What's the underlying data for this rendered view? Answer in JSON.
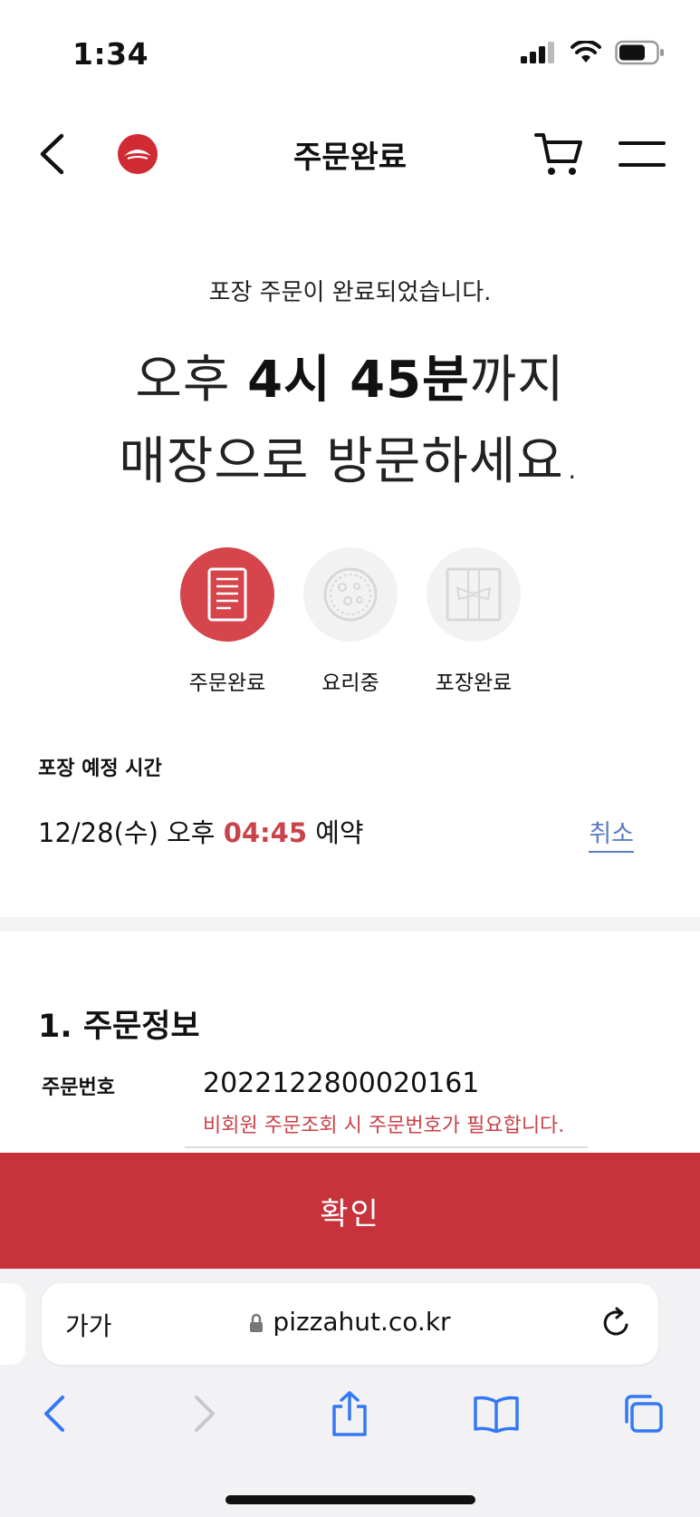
{
  "status_bar": {
    "time": "1:34"
  },
  "header": {
    "title": "주문완료"
  },
  "message": {
    "small": "포장 주문이 완료되었습니다.",
    "line1_prefix": "오후 ",
    "line1_bold": "4시 45분",
    "line1_suffix": "까지",
    "line2": "매장으로 방문하세요."
  },
  "steps": [
    {
      "label": "주문완료",
      "icon": "receipt-icon",
      "active": true
    },
    {
      "label": "요리중",
      "icon": "pizza-icon",
      "active": false
    },
    {
      "label": "포장완료",
      "icon": "package-icon",
      "active": false
    }
  ],
  "reservation": {
    "section_label": "포장 예정 시간",
    "date_prefix": "12/28(수) 오후 ",
    "time": "04:45",
    "suffix": " 예약",
    "cancel": "취소"
  },
  "order_info": {
    "title": "1. 주문정보",
    "order_no_label": "주문번호",
    "order_no": "2022122800020161",
    "note": "비회원 주문조회 시 주문번호가 필요합니다."
  },
  "confirm_button": "확인",
  "browser": {
    "aa": "가가",
    "url": "pizzahut.co.kr"
  },
  "colors": {
    "brand_red": "#c8333b",
    "accent_red": "#d5454b",
    "link_blue": "#5a7ec0",
    "ios_blue": "#3478f6"
  }
}
